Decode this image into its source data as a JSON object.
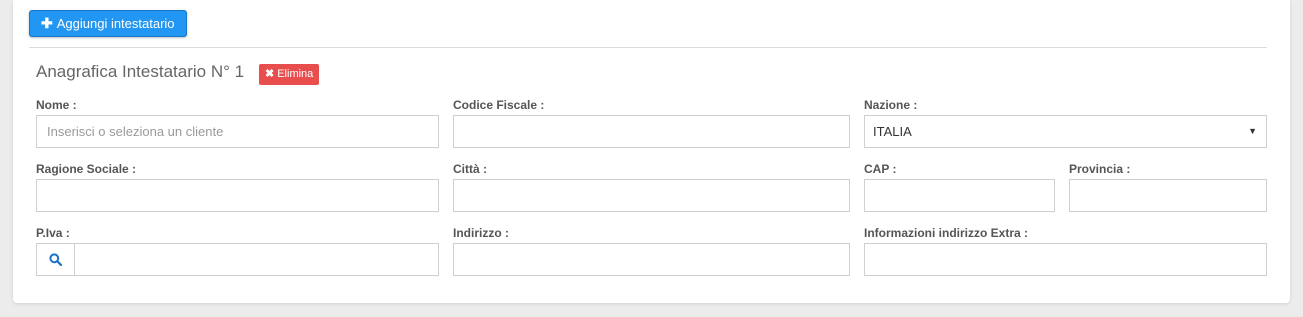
{
  "toolbar": {
    "add_label": "Aggiungi intestatario",
    "add_icon": "plus-icon"
  },
  "section": {
    "title": "Anagrafica Intestatario N° 1",
    "delete_label": "Elimina",
    "delete_icon": "close-icon"
  },
  "form": {
    "nome": {
      "label": "Nome :",
      "placeholder": "Inserisci o seleziona un cliente",
      "value": ""
    },
    "codice_fiscale": {
      "label": "Codice Fiscale :",
      "value": ""
    },
    "nazione": {
      "label": "Nazione :",
      "value": "ITALIA"
    },
    "ragione_sociale": {
      "label": "Ragione Sociale :",
      "value": ""
    },
    "citta": {
      "label": "Città :",
      "value": ""
    },
    "cap": {
      "label": "CAP :",
      "value": ""
    },
    "provincia": {
      "label": "Provincia :",
      "value": ""
    },
    "piva": {
      "label": "P.Iva :",
      "value": "",
      "icon": "search-icon"
    },
    "indirizzo": {
      "label": "Indirizzo :",
      "value": ""
    },
    "info_extra": {
      "label": "Informazioni indirizzo Extra :",
      "value": ""
    }
  },
  "colors": {
    "primary": "#2196f3",
    "danger": "#e84e4e"
  }
}
